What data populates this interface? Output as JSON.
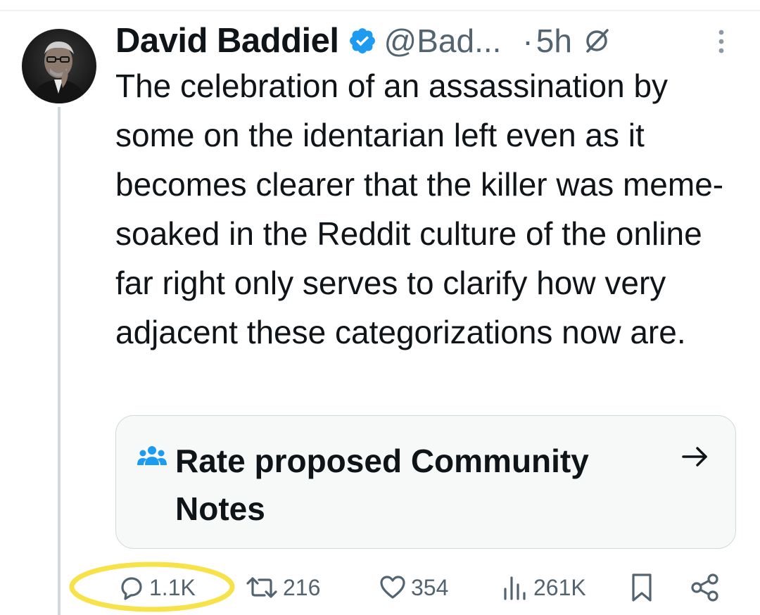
{
  "tweet": {
    "display_name": "David Baddiel",
    "handle": "@Bad...",
    "separator": "·",
    "time": "5h",
    "text": "The celebration of an assassination by some on the identarian left even as it becomes clearer that the killer was meme-soaked in the Reddit culture of the online far right only serves to clarify how very adjacent these categorizations now are."
  },
  "community_note": {
    "label": "Rate proposed Community Notes"
  },
  "actions": {
    "replies": "1.1K",
    "reposts": "216",
    "likes": "354",
    "views": "261K"
  },
  "colors": {
    "verified_blue": "#1d9bf0",
    "highlight_yellow": "#f7e24a",
    "secondary_text": "#536471"
  },
  "icons": [
    "verified-badge-icon",
    "grok-icon",
    "more-icon",
    "community-icon",
    "arrow-right-icon",
    "reply-icon",
    "repost-icon",
    "like-icon",
    "views-icon",
    "bookmark-icon",
    "share-icon"
  ]
}
